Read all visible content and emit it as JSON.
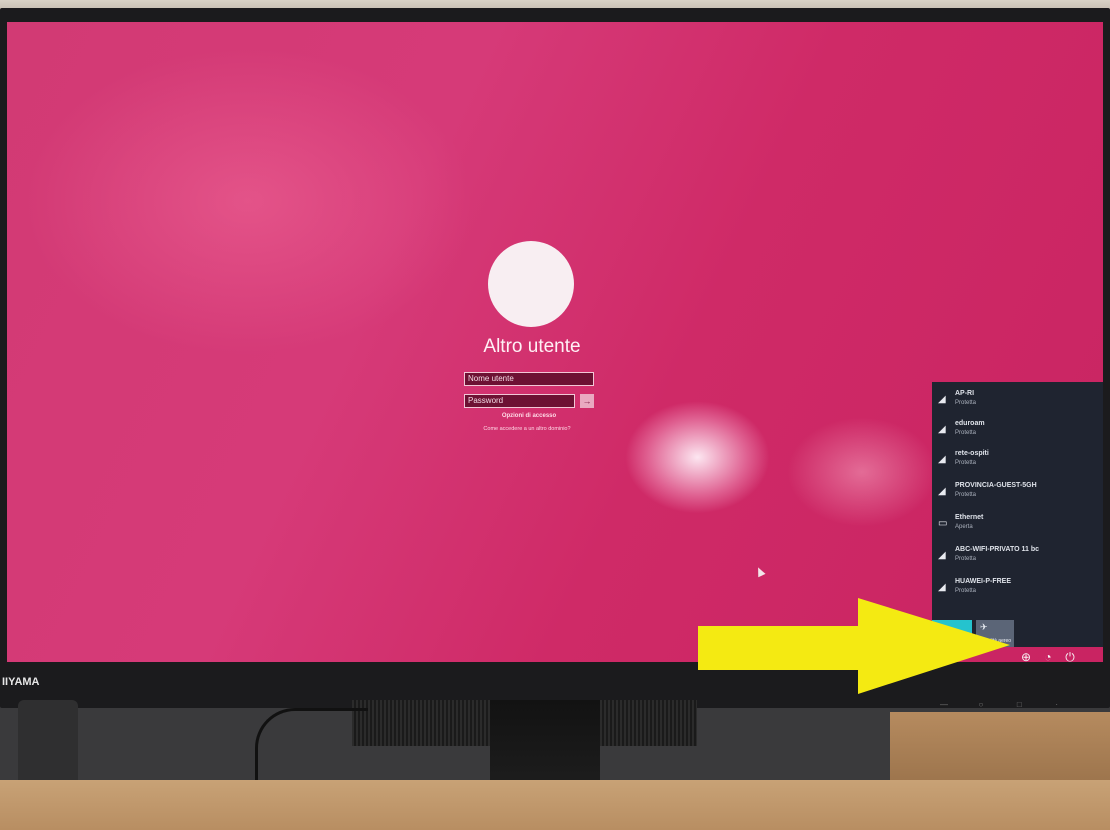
{
  "login": {
    "username_title": "Altro utente",
    "user_field_value": "Nome utente",
    "password_placeholder": "Password",
    "submit_glyph": "→",
    "signin_options": "Opzioni di accesso",
    "other_domain": "Come accedere a un altro dominio?"
  },
  "network": {
    "items": [
      {
        "icon": "wifi-icon",
        "glyph": "◢",
        "name": "AP-RI",
        "status": "Protetta"
      },
      {
        "icon": "wifi-icon",
        "glyph": "◢",
        "name": "eduroam",
        "status": "Protetta"
      },
      {
        "icon": "wifi-icon",
        "glyph": "◢",
        "name": "rete-ospiti",
        "status": "Protetta"
      },
      {
        "icon": "wifi-icon",
        "glyph": "◢",
        "name": "PROVINCIA-GUEST-5GH",
        "status": "Protetta"
      },
      {
        "icon": "ethernet-icon",
        "glyph": "▭",
        "name": "Ethernet",
        "status": "Aperta"
      },
      {
        "icon": "wifi-icon",
        "glyph": "◢",
        "name": "ABC-WIFI-PRIVATO 11 bc",
        "status": "Protetta"
      },
      {
        "icon": "wifi-icon",
        "glyph": "◢",
        "name": "HUAWEI-P-FREE",
        "status": "Protetta"
      }
    ],
    "tiles": {
      "airplane_label": "Modalità aereo",
      "airplane_glyph": "✈"
    }
  },
  "bottom_icons": {
    "network_glyph": "⊕",
    "ease_glyph": "◔",
    "power_glyph": "⏻"
  },
  "monitor": {
    "brand": "IIYAMA"
  },
  "colors": {
    "background": "#d23a74",
    "arrow": "#f4ea12",
    "wifi_tile": "#25c3ce"
  }
}
